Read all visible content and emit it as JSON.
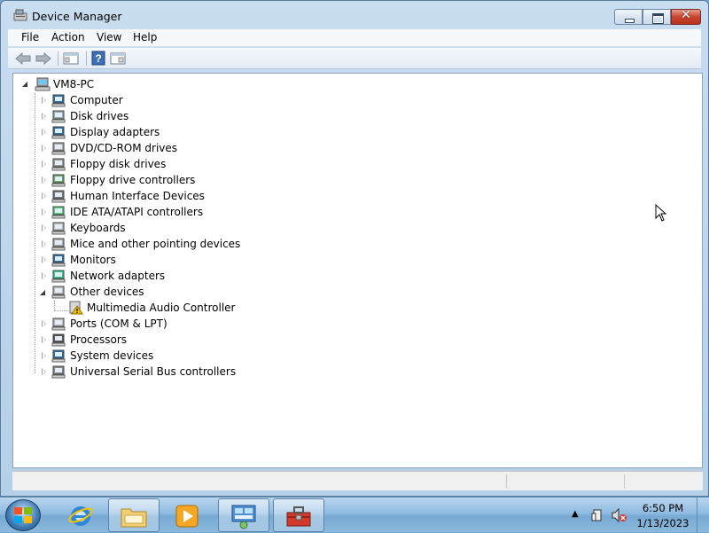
{
  "window": {
    "title": "Device Manager"
  },
  "menu": [
    "File",
    "Action",
    "View",
    "Help"
  ],
  "tree": {
    "root": "VM8-PC",
    "categories": [
      "Computer",
      "Disk drives",
      "Display adapters",
      "DVD/CD-ROM drives",
      "Floppy disk drives",
      "Floppy drive controllers",
      "Human Interface Devices",
      "IDE ATA/ATAPI controllers",
      "Keyboards",
      "Mice and other pointing devices",
      "Monitors",
      "Network adapters",
      "Other devices",
      "Ports (COM & LPT)",
      "Processors",
      "System devices",
      "Universal Serial Bus controllers"
    ],
    "expanded_child": "Multimedia Audio Controller"
  },
  "taskbar": {
    "clock_time": "6:50 PM",
    "clock_date": "1/13/2023"
  },
  "icons": {
    "title": "device-manager-icon",
    "back": "back-arrow-icon",
    "forward": "forward-arrow-icon",
    "properties": "properties-icon",
    "help": "help-icon",
    "update": "update-driver-icon"
  },
  "colors": {
    "accent": "#2d6ea3",
    "warning": "#f2c200",
    "close": "#c8462f"
  }
}
